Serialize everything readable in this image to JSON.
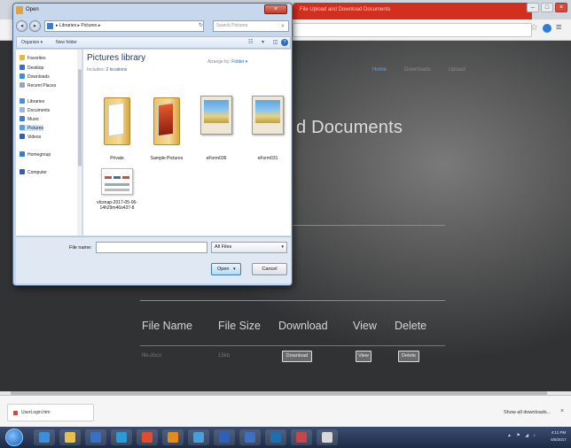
{
  "browser": {
    "tab_title": "File Upload and Download Documents",
    "window_controls": [
      "–",
      "□",
      "×"
    ],
    "star": "☆",
    "menu": "≡"
  },
  "page": {
    "nav": [
      "Home",
      "Downloads",
      "Upload"
    ],
    "heading": "d Documents",
    "table": {
      "headers": [
        "File Name",
        "File Size",
        "Download",
        "View",
        "Delete"
      ],
      "row": {
        "file_name": "file.docx",
        "file_size": "15kb",
        "download_btn": "Download",
        "view_btn": "View",
        "delete_btn": "Delete"
      }
    }
  },
  "download_shelf": {
    "item_label": "UserLogin.htm",
    "show_all": "Show all downloads...",
    "close": "×"
  },
  "taskbar": {
    "clock_time": "4:11 PM",
    "clock_date": "6/6/2017",
    "tray": "▲ ⚑ ◢ ♪",
    "app_colors": [
      "#3a8fd8",
      "#e8c14a",
      "#3a6fc8",
      "#2a9ad8",
      "#e24c2e",
      "#e88a1a",
      "#4a9ed8",
      "#2f5fb8",
      "#3c70c0",
      "#1f6fb0",
      "#c8454a",
      "#d8d8d8"
    ]
  },
  "dialog": {
    "title": "Open",
    "close": "×",
    "back": "◂",
    "forward": "▸",
    "address": "▸ Libraries ▸ Pictures ▸",
    "refresh": "↻",
    "search_placeholder": "Search Pictures",
    "search_icon": "⌕",
    "organize": "Organize ▾",
    "new_folder": "New folder",
    "cmd_icons": "☷ ▾ ◫",
    "help": "?",
    "nav_pane": [
      {
        "label": "Favorites",
        "icon": "star-icon",
        "color": "#e8b83a"
      },
      {
        "label": "Desktop",
        "icon": "desktop-icon",
        "color": "#3a6fc8"
      },
      {
        "label": "Downloads",
        "icon": "downloads-icon",
        "color": "#3a8fd8"
      },
      {
        "label": "Recent Places",
        "icon": "recent-places-icon",
        "color": "#9aa6b8"
      },
      {
        "label": "Libraries",
        "icon": "libraries-icon",
        "color": "#4a8fd8"
      },
      {
        "label": "Documents",
        "icon": "documents-icon",
        "color": "#9ab6d8"
      },
      {
        "label": "Music",
        "icon": "music-icon",
        "color": "#3a7fd0"
      },
      {
        "label": "Pictures",
        "icon": "pictures-icon",
        "color": "#5aa0d8"
      },
      {
        "label": "Videos",
        "icon": "videos-icon",
        "color": "#2f5fb0"
      },
      {
        "label": "Homegroup",
        "icon": "homegroup-icon",
        "color": "#2f80d8"
      },
      {
        "label": "Computer",
        "icon": "computer-icon",
        "color": "#2f5fb0"
      }
    ],
    "library_title": "Pictures library",
    "library_sub_prefix": "Includes:",
    "library_sub_link": "2 locations",
    "arrange_prefix": "Arrange by:",
    "arrange_value": "Folder ▾",
    "files": [
      {
        "name": "Private",
        "kind": "folder"
      },
      {
        "name": "Sample Pictures",
        "kind": "pics"
      },
      {
        "name": "eForm036",
        "kind": "photo"
      },
      {
        "name": "eForm031",
        "kind": "photo"
      },
      {
        "name": "vlcsnap-2017-05-06-14h29m46s437-8",
        "kind": "doc"
      }
    ],
    "filename_label": "File name:",
    "filename_value": "",
    "filter": "All Files",
    "open_btn": "Open",
    "cancel_btn": "Cancel",
    "dropdown_glyph": "▾"
  }
}
